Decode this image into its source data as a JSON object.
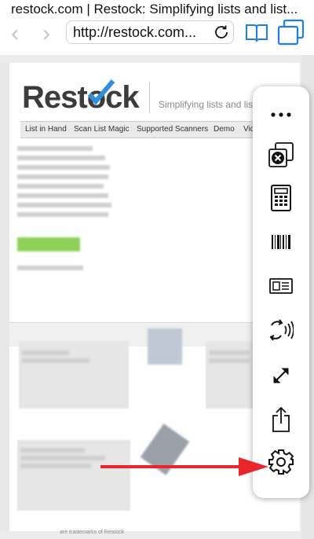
{
  "browser": {
    "page_title": "restock.com | Restock: Simplifying lists and list...",
    "url": "http://restock.com..."
  },
  "site": {
    "logo_text": "Restock",
    "tagline": "Simplifying lists and list m",
    "menu": [
      "List in Hand",
      "Scan List Magic",
      "Supported Scanners",
      "Demo",
      "Video"
    ],
    "footer": "are trademarks of Restock"
  },
  "toolbar": {
    "items": [
      "more-icon",
      "close-tabs-icon",
      "calculator-icon",
      "barcode-icon",
      "id-card-icon",
      "sound-icon",
      "expand-icon",
      "share-icon",
      "settings-icon"
    ]
  },
  "annotation": {
    "arrow_color": "#e8262c"
  },
  "colors": {
    "accent_blue": "#2f8fdc",
    "icon_blue": "#1e7cf2"
  }
}
